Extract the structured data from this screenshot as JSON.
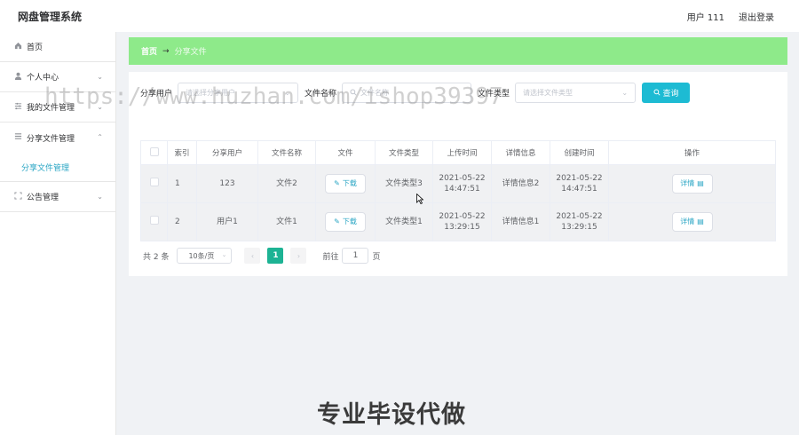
{
  "app": {
    "title": "网盘管理系统",
    "user_label": "用户 111",
    "logout_label": "退出登录"
  },
  "sidebar": {
    "home": "首页",
    "personal": "个人中心",
    "my_files": "我的文件管理",
    "share_mgmt": "分享文件管理",
    "share_sub": "分享文件管理",
    "notice": "公告管理"
  },
  "breadcrumb": {
    "home": "首页",
    "sep": "→",
    "current": "分享文件"
  },
  "filters": {
    "share_user_label": "分享用户",
    "share_user_placeholder": "请选择分享用户",
    "file_name_label": "文件名称",
    "file_name_placeholder": "文件名称",
    "file_type_label": "文件类型",
    "file_type_placeholder": "请选择文件类型",
    "query_label": "查询"
  },
  "table": {
    "headers": [
      "索引",
      "分享用户",
      "文件名称",
      "文件",
      "文件类型",
      "上传时间",
      "详情信息",
      "创建时间",
      "操作"
    ],
    "download_label": "下载",
    "detail_label": "详情",
    "rows": [
      {
        "index": "1",
        "user": "123",
        "name": "文件2",
        "type": "文件类型3",
        "upload_date": "2021-05-22",
        "upload_time": "14:47:51",
        "info": "详情信息2",
        "created_date": "2021-05-22",
        "created_time": "14:47:51"
      },
      {
        "index": "2",
        "user": "用户1",
        "name": "文件1",
        "type": "文件类型1",
        "upload_date": "2021-05-22",
        "upload_time": "13:29:15",
        "info": "详情信息1",
        "created_date": "2021-05-22",
        "created_time": "13:29:15"
      }
    ]
  },
  "pagination": {
    "total": "共 2 条",
    "page_size": "10条/页",
    "prev": "‹",
    "current": "1",
    "next": "›",
    "goto_label": "前往",
    "goto_value": "1",
    "page_suffix": "页"
  },
  "overlay": {
    "watermark": "https://www.huzhan.com/ishop39397",
    "banner": "专业毕设代做"
  },
  "colors": {
    "accent": "#1dbbd3",
    "breadcrumb_bg": "#8eea8a",
    "active_page": "#1db394"
  }
}
